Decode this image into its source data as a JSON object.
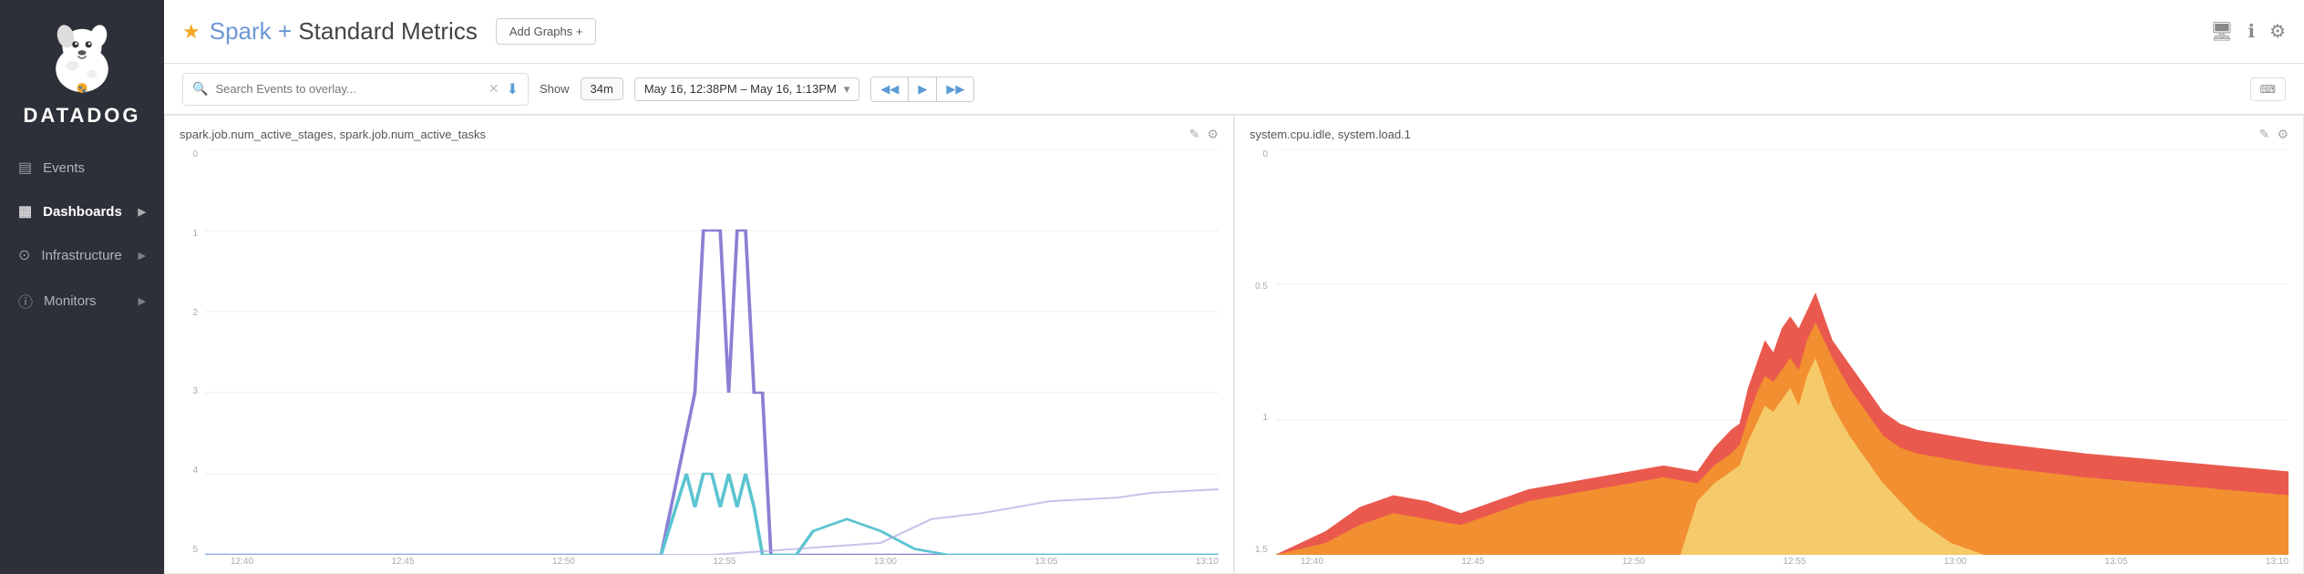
{
  "sidebar": {
    "brand": "DATADOG",
    "items": [
      {
        "id": "events",
        "label": "Events",
        "icon": "≡",
        "hasChevron": false
      },
      {
        "id": "dashboards",
        "label": "Dashboards",
        "icon": "▦",
        "hasChevron": true,
        "active": true
      },
      {
        "id": "infrastructure",
        "label": "Infrastructure",
        "icon": "⊙",
        "hasChevron": true
      },
      {
        "id": "monitors",
        "label": "Monitors",
        "icon": "ⓘ",
        "hasChevron": true
      }
    ]
  },
  "header": {
    "title_prefix": "Spark",
    "title_connector": "+",
    "title_suffix": "Standard Metrics",
    "add_graphs_label": "Add Graphs +",
    "icons": [
      "monitor",
      "info",
      "settings"
    ]
  },
  "toolbar": {
    "search_placeholder": "Search Events to overlay...",
    "show_label": "Show",
    "time_duration": "34m",
    "time_range": "May 16, 12:38PM – May 16, 1:13PM",
    "keyboard_label": "⌨"
  },
  "charts": [
    {
      "id": "chart1",
      "title": "spark.job.num_active_stages, spark.job.num_active_tasks",
      "y_labels": [
        "0",
        "1",
        "2",
        "3",
        "4",
        "5"
      ],
      "x_labels": [
        "12:40",
        "12:45",
        "12:50",
        "12:55",
        "13:00",
        "13:05",
        "13:10"
      ],
      "type": "line"
    },
    {
      "id": "chart2",
      "title": "system.cpu.idle, system.load.1",
      "y_labels": [
        "0",
        "0.5",
        "1",
        "1.5"
      ],
      "x_labels": [
        "12:40",
        "12:45",
        "12:50",
        "12:55",
        "13:00",
        "13:05",
        "13:10"
      ],
      "type": "area"
    }
  ],
  "colors": {
    "sidebar_bg": "#2d3038",
    "accent_blue": "#5b9bd5",
    "star_yellow": "#f5a623",
    "chart1_purple": "#8b7fd4",
    "chart1_cyan": "#5bc4d1",
    "chart1_lavender": "#b0a8e0",
    "chart2_red": "#e63c2f",
    "chart2_orange": "#f5a623",
    "chart2_yellow": "#f5d87a"
  }
}
